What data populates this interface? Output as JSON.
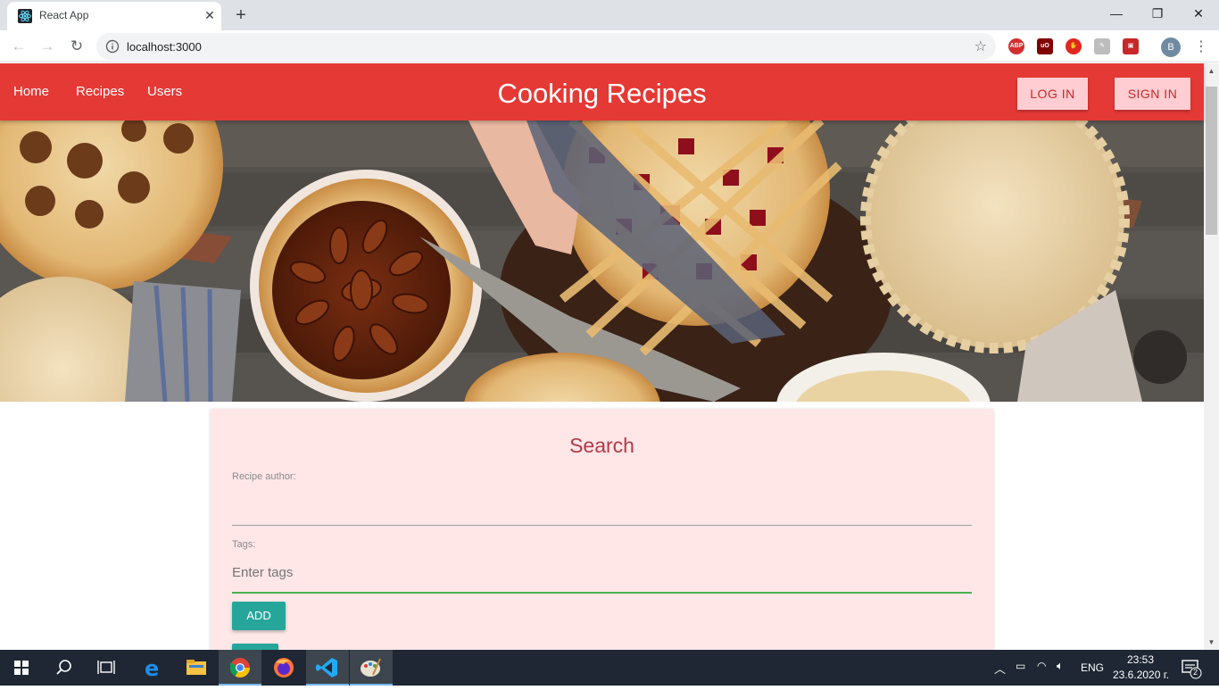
{
  "browser": {
    "tab_title": "React App",
    "url": "localhost:3000",
    "profile_initial": "B",
    "extensions": [
      {
        "icon": "adblock-plus-icon",
        "label": "ABP",
        "color": "#d32f2f"
      },
      {
        "icon": "ublock-origin-icon",
        "label": "uO",
        "color": "#800000"
      },
      {
        "icon": "stop-hand-icon",
        "label": "",
        "color": "#e0281e"
      },
      {
        "icon": "script-extension-icon",
        "label": "",
        "color": "#bdbdbd"
      },
      {
        "icon": "image-extension-icon",
        "label": "",
        "color": "#c62828"
      }
    ]
  },
  "app": {
    "nav": [
      {
        "label": "Home"
      },
      {
        "label": "Recipes"
      },
      {
        "label": "Users"
      }
    ],
    "title": "Cooking Recipes",
    "login_label": "LOG IN",
    "signin_label": "SIGN IN",
    "colors": {
      "primary": "#e53935",
      "accent": "#26a69a",
      "card": "#ffe7e8"
    }
  },
  "search": {
    "title": "Search",
    "author_label": "Recipe author:",
    "author_value": "",
    "tags_label": "Tags:",
    "tags_placeholder": "Enter tags",
    "add_label": "ADD"
  },
  "taskbar": {
    "language": "ENG",
    "time": "23:53",
    "date": "23.6.2020 г.",
    "notifications": "2"
  }
}
